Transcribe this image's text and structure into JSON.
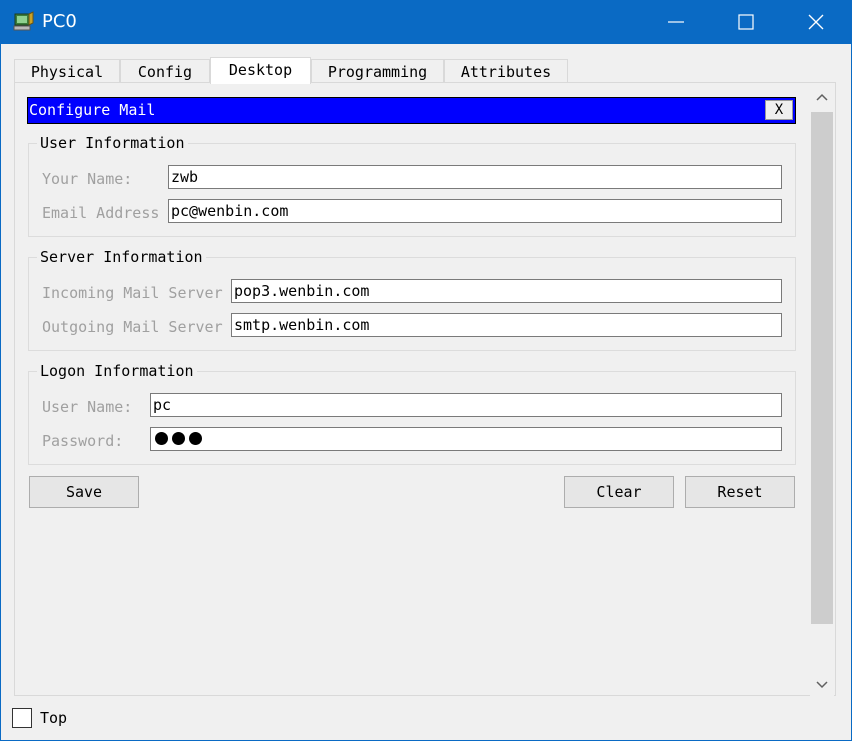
{
  "window": {
    "title": "PC0",
    "icon": "pc-device-icon",
    "controls": [
      "minimize-icon",
      "maximize-icon",
      "close-icon"
    ]
  },
  "tabs": [
    {
      "label": "Physical",
      "active": false
    },
    {
      "label": "Config",
      "active": false
    },
    {
      "label": "Desktop",
      "active": true
    },
    {
      "label": "Programming",
      "active": false
    },
    {
      "label": "Attributes",
      "active": false
    }
  ],
  "mail": {
    "title": "Configure Mail",
    "close_label": "X",
    "user_info": {
      "legend": "User Information",
      "name_label": "Your Name:",
      "name_value": "zwb",
      "email_label": "Email Address",
      "email_value": "pc@wenbin.com"
    },
    "server_info": {
      "legend": "Server Information",
      "incoming_label": "Incoming Mail Server",
      "incoming_value": "pop3.wenbin.com",
      "outgoing_label": "Outgoing Mail Server",
      "outgoing_value": "smtp.wenbin.com"
    },
    "logon_info": {
      "legend": "Logon Information",
      "username_label": "User Name:",
      "username_value": "pc",
      "password_label": "Password:",
      "password_mask_count": 3
    },
    "buttons": {
      "save": "Save",
      "clear": "Clear",
      "reset": "Reset"
    }
  },
  "footer": {
    "top_label": "Top",
    "top_checked": false
  },
  "colors": {
    "titlebar": "#0a6ac4",
    "mail_header": "#0000ff",
    "label_gray": "#a0a0a0"
  }
}
